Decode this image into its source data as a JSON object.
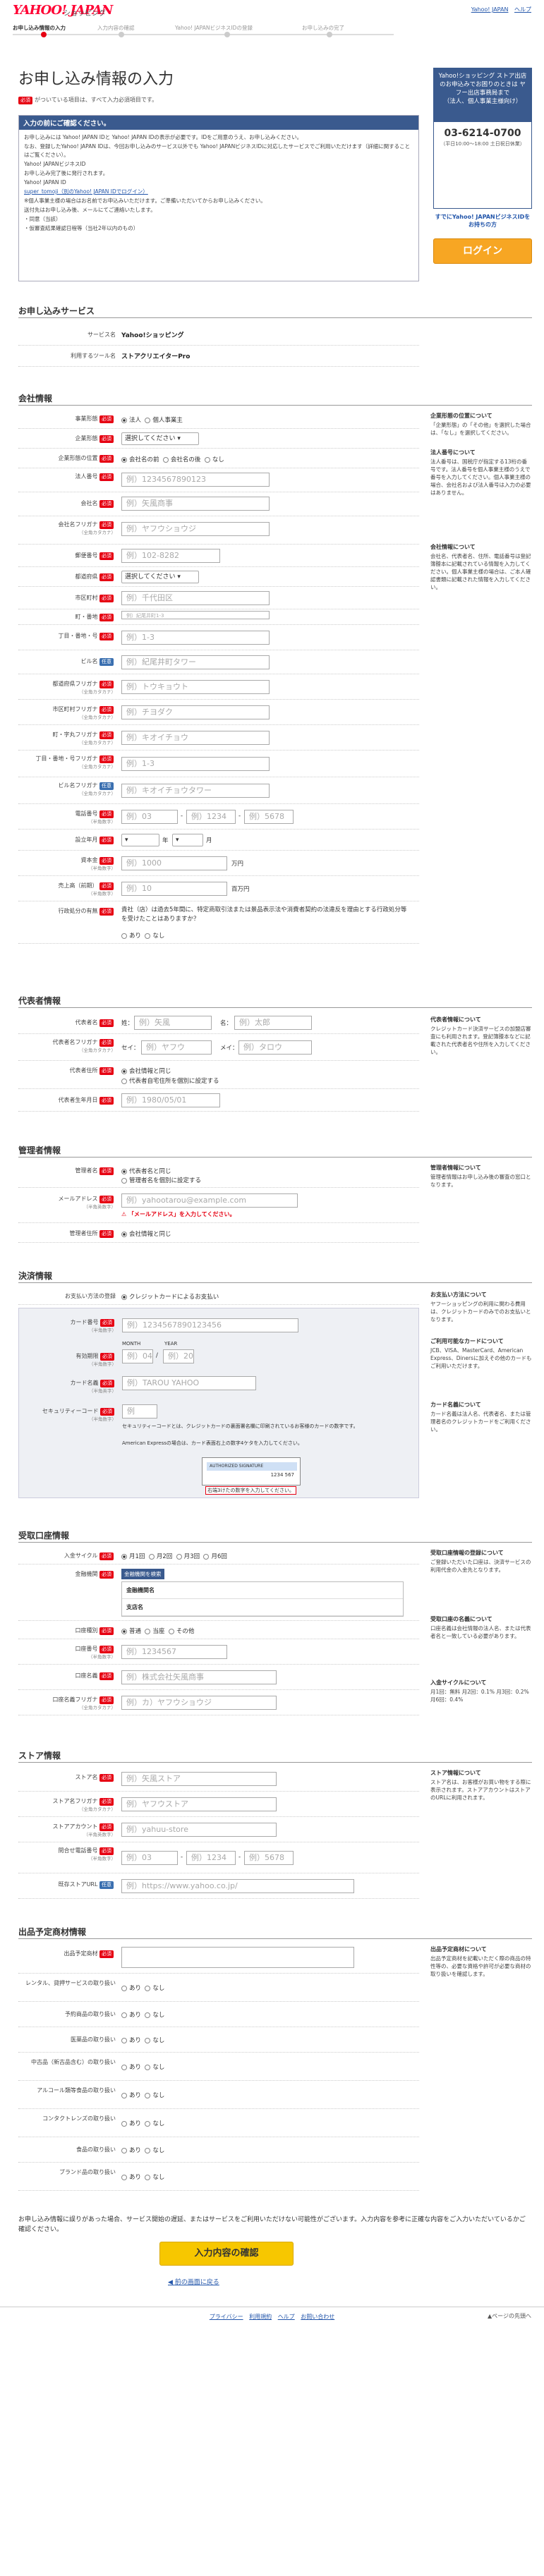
{
  "header": {
    "logo": "YAHOO! JAPAN",
    "logo_sub": "ショッピング",
    "links": [
      "Yahoo! JAPAN",
      "ヘルプ"
    ]
  },
  "steps": [
    "お申し込み情報の入力",
    "入力内容の確認",
    "Yahoo! JAPANビジネスIDの登録",
    "お申し込みの完了"
  ],
  "page_title": "お申し込み情報の入力",
  "required_note": "がついている項目は、すべて入力必須項目です。",
  "required_badge": "必須",
  "optional_badge": "任意",
  "infobox": {
    "title": "入力の前にご確認ください。",
    "lines": [
      "お申し込みには Yahoo! JAPAN IDと Yahoo! JAPAN IDの表示が必要です。IDをご用意のうえ、お申し込みください。",
      "なお、登録したYahoo! JAPAN IDは、今回お申し込みのサービス以外でも Yahoo! JAPANビジネスIDに対応したサービスでご利用いただけます（詳細に関することはご覧ください）。",
      "Yahoo! JAPANビジネスID",
      "お申し込み完了後に発行されます。",
      "Yahoo! JAPAN ID",
      "super_tomoji（別のYahoo! JAPAN IDでログイン）",
      "※個人事業主様の場合はお名前でお申込みいただけます。ご準備いただいてからお申し込みください。",
      "送付先はお申し込み後、メールにてご連絡いたします。",
      "・同意（当該）",
      "・仮審査結果確認日程等（当社2年以内のもの）"
    ]
  },
  "sidebox": {
    "title": "Yahoo!ショッピング ストア出店のお申込みでお困りのときは ヤフー出店事務局まで",
    "sub": "（法人、個人事業主様向け）",
    "tel": "03-6214-0700",
    "hours": "（平日10:00〜18:00 土日祝日休業）"
  },
  "side_login": {
    "text": "すでにYahoo! JAPANビジネスIDをお持ちの方",
    "button": "ログイン"
  },
  "sections": {
    "apply": "お申し込みサービス",
    "company": "会社情報",
    "rep": "代表者情報",
    "manager": "管理者情報",
    "payment": "決済情報",
    "bank": "受取口座情報",
    "store": "ストア情報",
    "products": "出品予定商材情報"
  },
  "apply": {
    "service_label": "サービス名",
    "service_value": "Yahoo!ショッピング",
    "tool_label": "利用するツール名",
    "tool_value": "ストアクリエイターPro"
  },
  "company": {
    "type_label": "事業形態",
    "type_opts": [
      "法人",
      "個人事業主"
    ],
    "industry_label": "企業形態",
    "industry_sel": "選択してください",
    "name_pos_label": "企業形態の位置",
    "name_pos_opts": [
      "会社名の前",
      "会社名の後",
      "なし"
    ],
    "corp_no_label": "法人番号",
    "corp_no_ph": "例）1234567890123",
    "name_label": "会社名",
    "name_ph": "例）矢風商事",
    "name_kana_label": "会社名フリガナ",
    "name_kana_sub": "（全角カタカナ）",
    "name_kana_ph": "例）ヤフウショウジ",
    "zip_label": "郵便番号",
    "zip_ph": "例）102-8282",
    "pref_label": "都道府県",
    "pref_sel": "選択してください",
    "city_label": "市区町村",
    "city_ph": "例）千代田区",
    "town_label": "町・番地",
    "town_ph": "例）紀尾井町1-3",
    "chome_label": "丁目・番地・号",
    "chome_ph": "例）1-3",
    "bldg_label": "ビル名",
    "bldg_ph": "例）紀尾井町タワー",
    "pref_kana_label": "都道府県フリガナ",
    "pref_kana_ph": "例）トウキョウト",
    "city_kana_label": "市区町村フリガナ",
    "city_kana_ph": "例）チヨダク",
    "town_kana_label": "町・字丸フリガナ",
    "town_kana_ph": "例）キオイチョウ",
    "chome_kana_label": "丁目・番地・号フリガナ",
    "chome_kana_ph": "例）1-3",
    "bldg_kana_label": "ビル名フリガナ",
    "bldg_kana_ph": "例）キオイチョウタワー",
    "tel_label": "電話番号",
    "tel_ph1": "例）03",
    "tel_ph2": "例）1234",
    "tel_ph3": "例）5678",
    "est_label": "設立年月",
    "est_year": "年",
    "est_month": "月",
    "capital_label": "資本金",
    "capital_ph": "例）1000",
    "capital_unit": "万円",
    "sales_label": "売上高（前期）",
    "sales_ph": "例）10",
    "sales_unit": "百万円",
    "admin_label": "行政処分の有無",
    "admin_q": "貴社（店）は過去5年間に、特定商取引法または景品表示法や消費者契約の法違反を理由とする行政処分等を受けたことはありますか？",
    "admin_opts": [
      "あり",
      "なし"
    ]
  },
  "company_side": [
    {
      "title": "企業形態の位置について",
      "text": "「企業形態」の「その他」を選択した場合は、「なし」を選択してください。"
    },
    {
      "title": "法人番号について",
      "text": "法人番号は、国税庁が指定する13桁の番号です。法人番号を個人事業主様のうえで 番号を入力してください。個人事業主様の場合、会社名および法人番号は入力の必要はありません。"
    },
    {
      "title": "会社情報について",
      "text": "会社名、代表者名、住所、電話番号は登記簿謄本に記載されている情報を入力してください。個人事業主様の場合は、ご本人確認書類に記載された情報を入力してください。"
    }
  ],
  "rep": {
    "name_label": "代表者名",
    "sei_ph": "例）矢風",
    "mei_label": "名",
    "mei_ph": "例）太郎",
    "kana_label": "代表者名フリガナ",
    "sei_k": "セイ",
    "sei_k_ph": "例）ヤフウ",
    "mei_k": "メイ",
    "mei_k_ph": "例）タロウ",
    "addr_label": "代表者住所",
    "addr_opts": [
      "会社情報と同じ",
      "代表者自宅住所を個別に設定する"
    ],
    "birth_label": "代表者生年月日",
    "birth_ph": "例）1980/05/01"
  },
  "rep_side": {
    "title": "代表者情報について",
    "text": "クレジットカード決済サービスの加盟店審査にも利用されます。登記簿謄本などに記載された代表者名や住所を入力してください。"
  },
  "manager": {
    "name_label": "管理者名",
    "name_opts": [
      "代表者名と同じ",
      "管理者名を個別に設定する"
    ],
    "mail_label": "メールアドレス",
    "mail_sub": "（半角英数字）",
    "mail_ph": "例）yahootarou@example.com",
    "mail_err": "「メールアドレス」を入力してください。",
    "addr_label": "管理者住所",
    "addr_opts": [
      "会社情報と同じ"
    ]
  },
  "manager_side": {
    "title": "管理者情報について",
    "text": "管理者情報はお申し込み後の審査の窓口となります。"
  },
  "payment": {
    "method_label": "お支払い方法の登録",
    "method_opt": "クレジットカードによるお支払い",
    "card_no_label": "カード番号",
    "card_no_sub": "（半角数字）",
    "card_no_ph": "例）1234567890123456",
    "exp_label": "有効期限",
    "month": "MONTH",
    "year": "YEAR",
    "exp_m": "例）04",
    "exp_y": "例）20",
    "holder_label": "カード名義",
    "holder_sub": "（半角英字）",
    "holder_ph": "例）TAROU YAHOO",
    "sec_label": "セキュリティーコード",
    "sec_sub": "（半角数字）",
    "sec_ph": "例",
    "sec_note": "セキュリティーコードとは、クレジットカードの裏面署名欄に印刷されているお客様のカードの数字です。",
    "amex_note": "American Expressの場合は、カード表面右上の数字4ケタを入力してください。",
    "card_caption": "右端3けたの数字を入力してください。",
    "card_stripe": "AUTHORIZED SIGNATURE",
    "card_num": "1234 567"
  },
  "payment_side": [
    {
      "title": "お支払い方法について",
      "text": "ヤフーショッピングの利用に関わる費用は、クレジットカードのみでのお支払いとなります。"
    },
    {
      "title": "ご利用可能なカードについて",
      "text": "JCB、VISA、MasterCard、American Express、Dinersに加えその他のカードもご利用いただけます。"
    },
    {
      "title": "カード名義について",
      "text": "カード名義は法人名、代表者名、または管理者名のクレジットカードをご利用ください。"
    }
  ],
  "bank": {
    "cycle_label": "入金サイクル",
    "cycle_opts": [
      "月1回",
      "月2回",
      "月3回",
      "月6回"
    ],
    "inst_label": "金融機関",
    "inst_btn": "金融機関を検索",
    "inst_rows": [
      "金融機関名",
      "支店名"
    ],
    "type_label": "口座種別",
    "type_opts": [
      "普通",
      "当座",
      "その他"
    ],
    "no_label": "口座番号",
    "no_ph": "例）1234567",
    "holder_label": "口座名義",
    "holder_ph": "例）株式会社矢風商事",
    "holder_kana_label": "口座名義フリガナ",
    "holder_kana_ph": "例）カ）ヤフウショウジ"
  },
  "bank_side": [
    {
      "title": "受取口座情報の登録について",
      "text": "ご登録いただいた口座は、決済サービスの利用代金の入金先となります。"
    },
    {
      "title": "受取口座の名義について",
      "text": "口座名義は会社情報の法人名、または代表者名と一致している必要があります。"
    },
    {
      "title": "入金サイクルについて",
      "text": "月1回：無料 月2回：0.1% 月3回：0.2% 月6回：0.4%"
    }
  ],
  "store": {
    "name_label": "ストア名",
    "name_ph": "例）矢風ストア",
    "kana_label": "ストア名フリガナ",
    "kana_ph": "例）ヤフウストア",
    "acct_label": "ストアアカウント",
    "acct_ph": "例）yahuu-store",
    "tel_label": "問合せ電話番号",
    "tel_ph1": "例）03",
    "tel_ph2": "例）1234",
    "tel_ph3": "例）5678",
    "url_label": "既存ストアURL",
    "url_ph": "例）https://www.yahoo.co.jp/"
  },
  "store_side": {
    "title": "ストア情報について",
    "text": "ストア名は、お客様がお買い物をする際に表示されます。ストアアカウントはストアのURLに利用されます。"
  },
  "products": {
    "plan_label": "出品予定商材",
    "rows": [
      {
        "label": "レンタル、貸押サービスの取り扱い",
        "opts": [
          "あり",
          "なし"
        ]
      },
      {
        "label": "予約商品の取り扱い",
        "opts": [
          "あり",
          "なし"
        ]
      },
      {
        "label": "医薬品の取り扱い",
        "opts": [
          "あり",
          "なし"
        ]
      },
      {
        "label": "中古品（新古品含む）の取り扱い",
        "opts": [
          "あり",
          "なし"
        ]
      },
      {
        "label": "アルコール類等食品の取り扱い",
        "opts": [
          "あり",
          "なし"
        ]
      },
      {
        "label": "コンタクトレンズの取り扱い",
        "opts": [
          "あり",
          "なし"
        ]
      },
      {
        "label": "食品の取り扱い",
        "opts": [
          "あり",
          "なし"
        ]
      },
      {
        "label": "ブランド品の取り扱い",
        "opts": [
          "あり",
          "なし"
        ]
      }
    ]
  },
  "products_side": {
    "title": "出品予定商材について",
    "text": "出品予定商材を記載いただく際の商品の特性等の、必要な資格や許可が必要な商材の取り扱いを確認します。"
  },
  "footer_msg": "お申し込み情報に誤りがあった場合、サービス開始の遅延、またはサービスをご利用いただけない可能性がございます。入力内容を参考に正確な内容をご入力いただいているかご確認ください。",
  "confirm_btn": "入力内容の確認",
  "back_link": "前の画面に戻る",
  "footer_links": [
    "プライバシー",
    "利用規約",
    "ヘルプ",
    "お問い合わせ"
  ],
  "pagetop": "▲ページの先頭へ"
}
